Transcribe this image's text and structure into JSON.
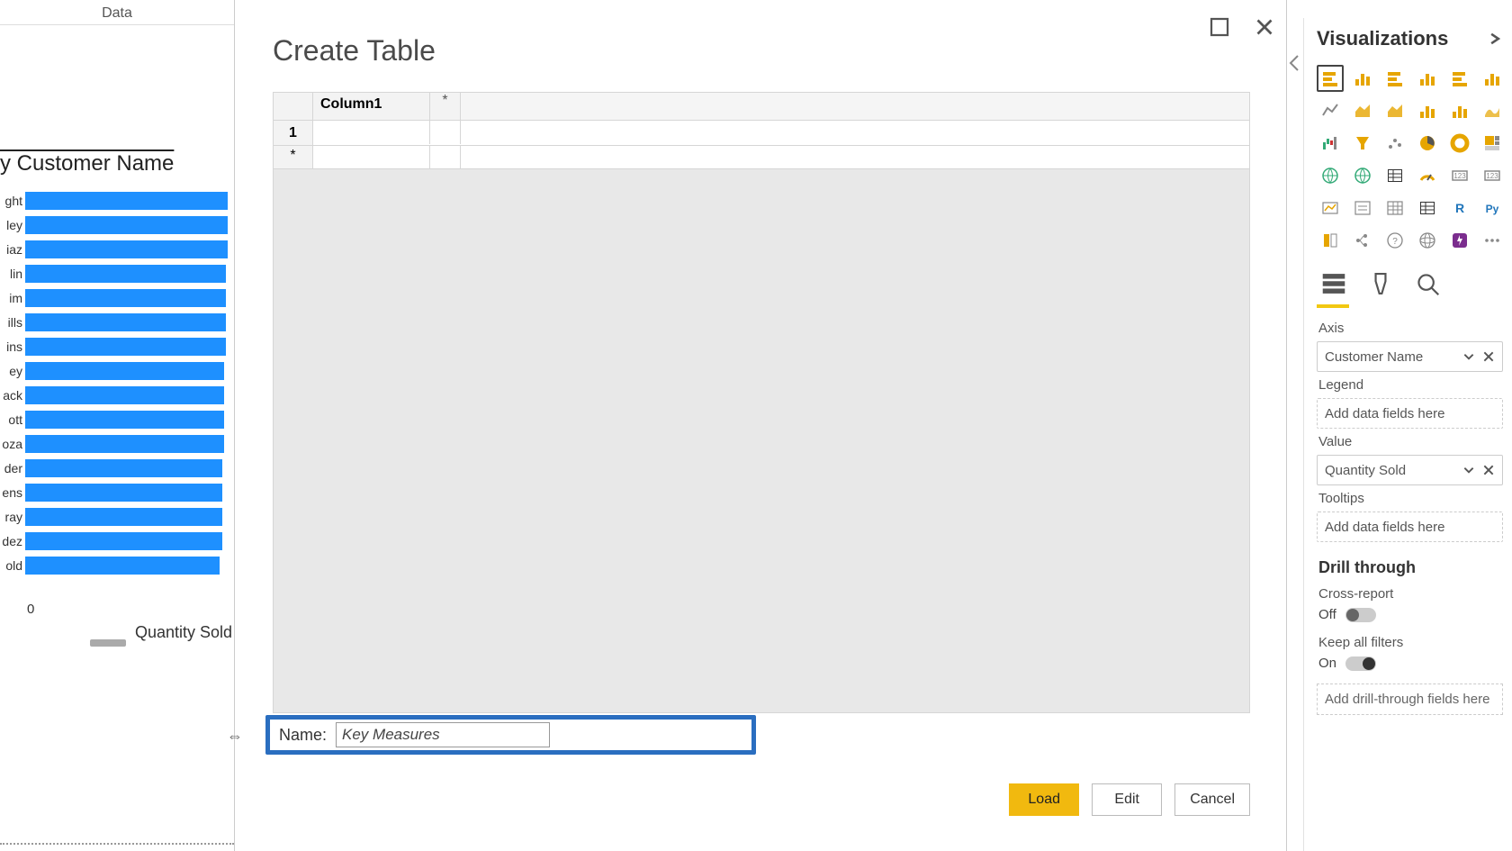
{
  "header": {
    "data_label": "Data"
  },
  "chart_data": {
    "type": "bar",
    "orientation": "horizontal",
    "title": "y Customer Name",
    "xlabel": "Quantity Sold",
    "ylabel": "",
    "xlim": [
      0,
      100
    ],
    "categories": [
      "ght",
      "ley",
      "iaz",
      "lin",
      "im",
      "ills",
      "ins",
      "ey",
      "ack",
      "ott",
      "oza",
      "der",
      "ens",
      "ray",
      "dez",
      "old"
    ],
    "values": [
      98,
      98,
      98,
      97,
      97,
      97,
      97,
      96,
      96,
      96,
      96,
      95,
      95,
      95,
      95,
      94
    ],
    "axis_zero": "0"
  },
  "modal": {
    "title": "Create Table",
    "grid": {
      "row_header_1": "1",
      "row_header_2": "*",
      "col_header_1": "Column1",
      "col_header_star": "*"
    },
    "name_label": "Name:",
    "name_value": "Key Measures",
    "buttons": {
      "load": "Load",
      "edit": "Edit",
      "cancel": "Cancel"
    }
  },
  "viz_panel": {
    "title": "Visualizations",
    "wells": {
      "axis_label": "Axis",
      "axis_value": "Customer Name",
      "legend_label": "Legend",
      "legend_placeholder": "Add data fields here",
      "value_label": "Value",
      "value_value": "Quantity Sold",
      "tooltips_label": "Tooltips",
      "tooltips_placeholder": "Add data fields here"
    },
    "drill": {
      "title": "Drill through",
      "cross_label": "Cross-report",
      "cross_state": "Off",
      "keep_label": "Keep all filters",
      "keep_state": "On",
      "add_placeholder": "Add drill-through fields here"
    }
  },
  "viz_icons": [
    "stacked-bar-icon",
    "clustered-column-icon",
    "stacked-column-icon",
    "clustered-bar-icon",
    "100stacked-bar-icon",
    "100stacked-column-icon",
    "line-icon",
    "area-icon",
    "stacked-area-icon",
    "line-clustered-icon",
    "line-stacked-icon",
    "ribbon-icon",
    "waterfall-icon",
    "funnel-icon",
    "scatter-icon",
    "pie-icon",
    "donut-icon",
    "treemap-icon",
    "map-icon",
    "filled-map-icon",
    "shape-map-icon",
    "gauge-icon",
    "card-icon",
    "multirow-card-icon",
    "kpi-icon",
    "slicer-icon",
    "table-icon",
    "matrix-icon",
    "r-visual-icon",
    "python-visual-icon",
    "key-influencers-icon",
    "decomposition-icon",
    "qa-icon",
    "arcgis-icon",
    "powerapps-icon",
    "more-icon"
  ]
}
